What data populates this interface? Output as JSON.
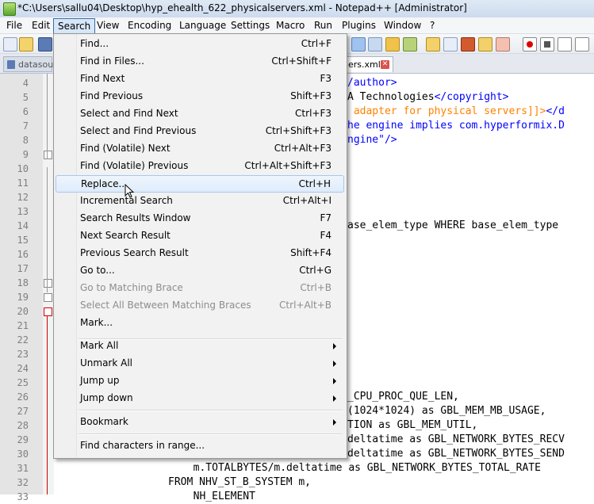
{
  "window": {
    "title": "*C:\\Users\\sallu04\\Desktop\\hyp_ehealth_622_physicalservers.xml - Notepad++ [Administrator]"
  },
  "menubar": [
    "File",
    "Edit",
    "Search",
    "View",
    "Encoding",
    "Language",
    "Settings",
    "Macro",
    "Run",
    "Plugins",
    "Window",
    "?"
  ],
  "active_menu": "Search",
  "tabs": {
    "inactive": "datasourc",
    "active": "ers.xml",
    "close_glyph": "✕"
  },
  "line_numbers": [
    "4",
    "5",
    "6",
    "7",
    "8",
    "9",
    "10",
    "11",
    "12",
    "13",
    "14",
    "15",
    "16",
    "17",
    "18",
    "19",
    "20",
    "21",
    "22",
    "23",
    "24",
    "25",
    "26",
    "27",
    "28",
    "29",
    "30",
    "31",
    "32",
    "33"
  ],
  "code_lines": [
    {
      "parts": [
        {
          "text": "/author>",
          "color": "blue"
        }
      ]
    },
    {
      "parts": [
        {
          "text": "A Technologies",
          "color": "black"
        },
        {
          "text": "</copyright>",
          "color": "blue"
        }
      ]
    },
    {
      "parts": [
        {
          "text": " adapter for physical servers]]>",
          "color": "orange"
        },
        {
          "text": "</d",
          "color": "blue"
        }
      ]
    },
    {
      "parts": [
        {
          "text": "he engine implies com.hyperformix.D",
          "color": "blue"
        }
      ]
    },
    {
      "parts": [
        {
          "text": "ngine\"/>",
          "color": "blue"
        }
      ]
    },
    {
      "parts": []
    },
    {
      "parts": []
    },
    {
      "parts": []
    },
    {
      "parts": []
    },
    {
      "parts": []
    },
    {
      "parts": [
        {
          "text": "ase_elem_type WHERE base_elem_type",
          "color": "black"
        }
      ]
    },
    {
      "parts": []
    },
    {
      "parts": []
    },
    {
      "parts": []
    },
    {
      "parts": []
    },
    {
      "parts": []
    },
    {
      "parts": []
    },
    {
      "parts": []
    },
    {
      "parts": []
    },
    {
      "parts": []
    },
    {
      "parts": []
    },
    {
      "parts": []
    },
    {
      "parts": [
        {
          "text": "_CPU_PROC_QUE_LEN,",
          "color": "black"
        }
      ]
    },
    {
      "parts": [
        {
          "text": "(1024*1024) as GBL_MEM_MB_USAGE,",
          "color": "black"
        }
      ]
    },
    {
      "parts": [
        {
          "text": "TION as GBL_MEM_UTIL,",
          "color": "black"
        }
      ]
    },
    {
      "parts": [
        {
          "text": "deltatime as GBL_NETWORK_BYTES_RECV",
          "color": "black"
        }
      ]
    },
    {
      "parts": [
        {
          "text": "deltatime as GBL_NETWORK_BYTES_SEND",
          "color": "black"
        }
      ]
    },
    {
      "parts": [
        {
          "text": "  m.TOTALBYTES/m.deltatime as GBL_NETWORK_BYTES_TOTAL_RATE",
          "color": "black"
        }
      ]
    },
    {
      "parts": [
        {
          "text": "FROM NHV_ST_B_SYSTEM m,",
          "color": "black"
        }
      ]
    },
    {
      "parts": [
        {
          "text": "  NH_ELEMENT",
          "color": "black"
        }
      ]
    }
  ],
  "search_menu": {
    "items": [
      {
        "label": "Find...",
        "shortcut": "Ctrl+F"
      },
      {
        "label": "Find in Files...",
        "shortcut": "Ctrl+Shift+F"
      },
      {
        "label": "Find Next",
        "shortcut": "F3"
      },
      {
        "label": "Find Previous",
        "shortcut": "Shift+F3"
      },
      {
        "label": "Select and Find Next",
        "shortcut": "Ctrl+F3"
      },
      {
        "label": "Select and Find Previous",
        "shortcut": "Ctrl+Shift+F3"
      },
      {
        "label": "Find (Volatile) Next",
        "shortcut": "Ctrl+Alt+F3"
      },
      {
        "label": "Find (Volatile) Previous",
        "shortcut": "Ctrl+Alt+Shift+F3"
      },
      {
        "label": "Replace...",
        "shortcut": "Ctrl+H",
        "hover": true
      },
      {
        "label": "Incremental Search",
        "shortcut": "Ctrl+Alt+I"
      },
      {
        "label": "Search Results Window",
        "shortcut": "F7"
      },
      {
        "label": "Next Search Result",
        "shortcut": "F4"
      },
      {
        "label": "Previous Search Result",
        "shortcut": "Shift+F4"
      },
      {
        "label": "Go to...",
        "shortcut": "Ctrl+G"
      },
      {
        "label": "Go to Matching Brace",
        "shortcut": "Ctrl+B",
        "disabled": true
      },
      {
        "label": "Select All Between Matching Braces",
        "shortcut": "Ctrl+Alt+B",
        "disabled": true
      },
      {
        "label": "Mark...",
        "shortcut": ""
      }
    ],
    "submenus": [
      {
        "label": "Mark All"
      },
      {
        "label": "Unmark All"
      },
      {
        "label": "Jump up"
      },
      {
        "label": "Jump down"
      }
    ],
    "bookmark": {
      "label": "Bookmark"
    },
    "find_chars": {
      "label": "Find characters in range..."
    }
  }
}
